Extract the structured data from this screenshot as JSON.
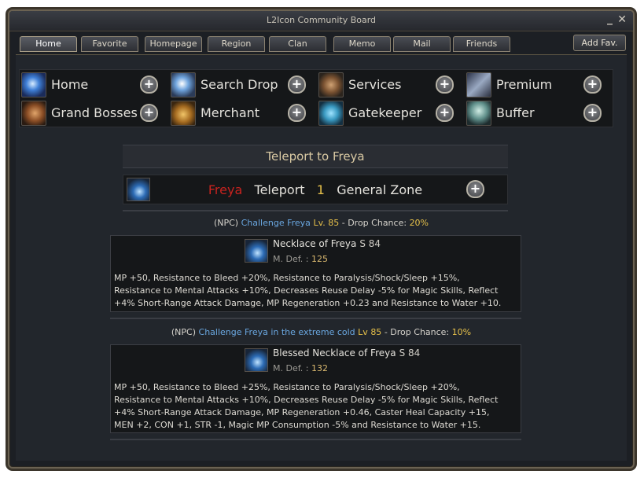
{
  "window": {
    "title": "L2Icon Community Board",
    "minimize": "_",
    "close": "✕"
  },
  "tabs": [
    "Home",
    "Favorite",
    "Homepage",
    "Region",
    "Clan",
    "Memo",
    "Mail",
    "Friends"
  ],
  "add_fav": "Add Fav.",
  "menu": [
    {
      "label": "Home",
      "icon": "home-icon"
    },
    {
      "label": "Search Drop",
      "icon": "search-drop-icon"
    },
    {
      "label": "Services",
      "icon": "services-gear-icon"
    },
    {
      "label": "Premium",
      "icon": "premium-icon"
    },
    {
      "label": "Grand Bosses",
      "icon": "grand-bosses-icon"
    },
    {
      "label": "Merchant",
      "icon": "merchant-chest-icon"
    },
    {
      "label": "Gatekeeper",
      "icon": "gatekeeper-swirl-icon"
    },
    {
      "label": "Buffer",
      "icon": "buffer-icon"
    }
  ],
  "plus_glyph": "+",
  "section": {
    "title": "Teleport to Freya"
  },
  "teleport": {
    "name": "Freya",
    "action": "Teleport",
    "count": "1",
    "zone": "General Zone"
  },
  "drops": [
    {
      "npc_prefix": "(NPC)",
      "npc_name": "Challenge Freya",
      "lv_label": "Lv.",
      "lv": "85",
      "dash": "-",
      "chance_label": "Drop Chance:",
      "chance": "20%",
      "item": {
        "name": "Necklace of Freya",
        "grade": "S 84",
        "def_label": "M. Def. :",
        "def": "125",
        "desc_lines": [
          "MP +50, Resistance to Bleed +20%, Resistance to Paralysis/Shock/Sleep +15%,",
          "Resistance to Mental Attacks +10%, Decreases Reuse Delay  -5% for Magic Skills, Reflect",
          "+4% Short-Range Attack Damage, MP Regeneration +0.23 and Resistance to Water +10."
        ]
      }
    },
    {
      "npc_prefix": "(NPC)",
      "npc_name": "Challenge Freya in the extreme cold",
      "lv_label": "Lv",
      "lv": "85",
      "dash": "-",
      "chance_label": "Drop Chance:",
      "chance": "10%",
      "item": {
        "name": "Blessed Necklace of Freya",
        "grade": "S 84",
        "def_label": "M. Def. :",
        "def": "132",
        "desc_lines": [
          "MP +50, Resistance to Bleed +25%, Resistance to Paralysis/Shock/Sleep +20%,",
          "Resistance to Mental Attacks +10%, Decreases Reuse Delay  -5% for Magic Skills, Reflect",
          "+4% Short-Range Attack Damage, MP Regeneration +0.46, Caster Heal Capacity +15,",
          "MEN +2, CON +1, STR -1, Magic MP Consumption  -5% and Resistance to Water +15."
        ]
      }
    }
  ]
}
